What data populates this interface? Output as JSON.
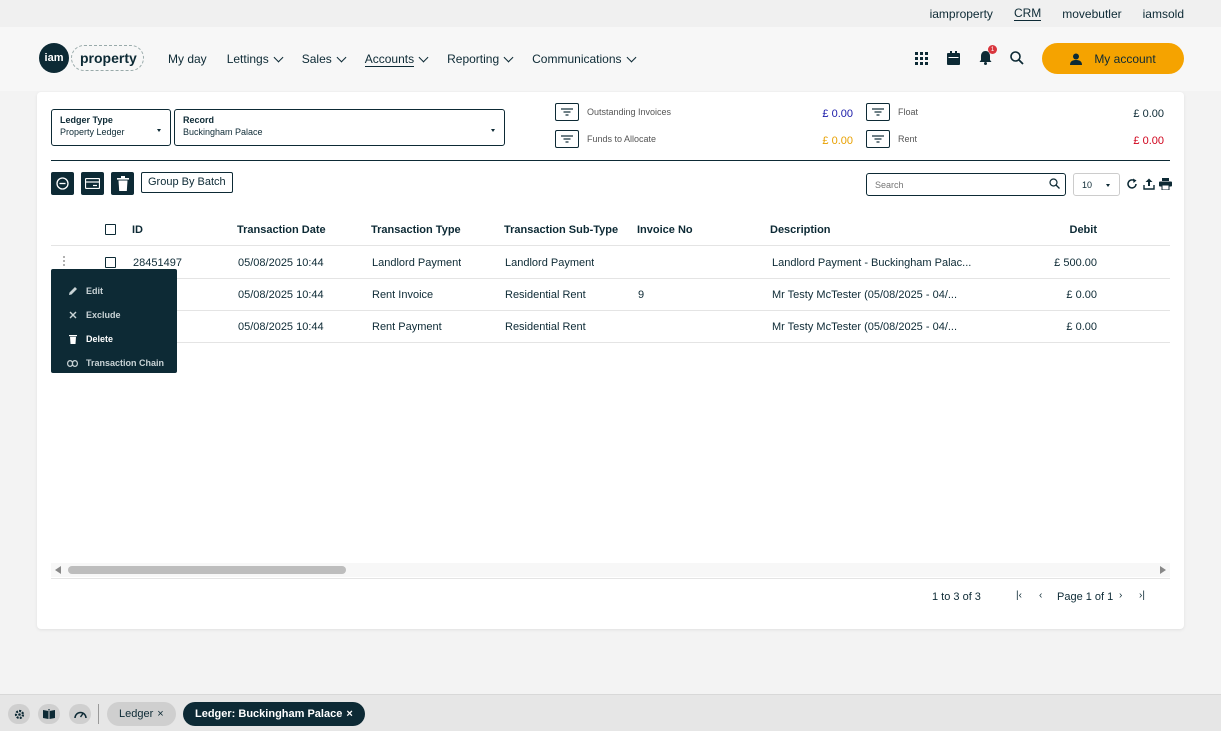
{
  "topbar": {
    "links": [
      {
        "label": "iamproperty",
        "active": false
      },
      {
        "label": "CRM",
        "active": true
      },
      {
        "label": "movebutler",
        "active": false
      },
      {
        "label": "iamsold",
        "active": false
      }
    ]
  },
  "logo": {
    "badge": "iam",
    "word": "property"
  },
  "nav": {
    "items": [
      {
        "label": "My day"
      },
      {
        "label": "Lettings"
      },
      {
        "label": "Sales"
      },
      {
        "label": "Accounts"
      },
      {
        "label": "Reporting"
      },
      {
        "label": "Communications"
      }
    ],
    "notification_count": "1",
    "account_label": "My account"
  },
  "filters": {
    "ledger_type_label": "Ledger Type",
    "ledger_type_value": "Property Ledger",
    "record_label": "Record",
    "record_value": "Buckingham Palace"
  },
  "summary": {
    "outstanding_invoices_label": "Outstanding Invoices",
    "outstanding_invoices_value": "£ 0.00",
    "funds_to_allocate_label": "Funds to Allocate",
    "funds_to_allocate_value": "£ 0.00",
    "float_label": "Float",
    "float_value": "£ 0.00",
    "rent_label": "Rent",
    "rent_value": "£ 0.00"
  },
  "colors": {
    "dark": "#0d2a35",
    "accent": "#f5a300",
    "blue": "#1a1aa8",
    "orange": "#e8a000",
    "red": "#d0021b"
  },
  "toolbar": {
    "group_by_batch": "Group By Batch",
    "search_placeholder": "Search",
    "page_size": "10"
  },
  "table": {
    "headers": {
      "id": "ID",
      "date": "Transaction Date",
      "type": "Transaction Type",
      "subtype": "Transaction Sub-Type",
      "invoice": "Invoice No",
      "description": "Description",
      "debit": "Debit"
    },
    "rows": [
      {
        "id": "28451497",
        "date": "05/08/2025 10:44",
        "type": "Landlord Payment",
        "subtype": "Landlord Payment",
        "invoice": "",
        "description": "Landlord Payment - Buckingham Palac...",
        "debit": "£ 500.00"
      },
      {
        "id": "",
        "date": "05/08/2025 10:44",
        "type": "Rent Invoice",
        "subtype": "Residential Rent",
        "invoice": "9",
        "description": "Mr Testy McTester (05/08/2025 - 04/...",
        "debit": "£ 0.00"
      },
      {
        "id": "",
        "date": "05/08/2025 10:44",
        "type": "Rent Payment",
        "subtype": "Residential Rent",
        "invoice": "",
        "description": "Mr Testy McTester (05/08/2025 - 04/...",
        "debit": "£ 0.00"
      }
    ]
  },
  "context_menu": {
    "items": [
      {
        "label": "Edit"
      },
      {
        "label": "Exclude"
      },
      {
        "label": "Delete"
      },
      {
        "label": "Transaction Chain"
      }
    ]
  },
  "pager": {
    "range": "1 to 3 of 3",
    "page": "Page 1 of 1"
  },
  "bottom_tabs": [
    {
      "label": "Ledger",
      "close": "×"
    },
    {
      "label": "Ledger: Buckingham Palace",
      "close": "×"
    }
  ]
}
